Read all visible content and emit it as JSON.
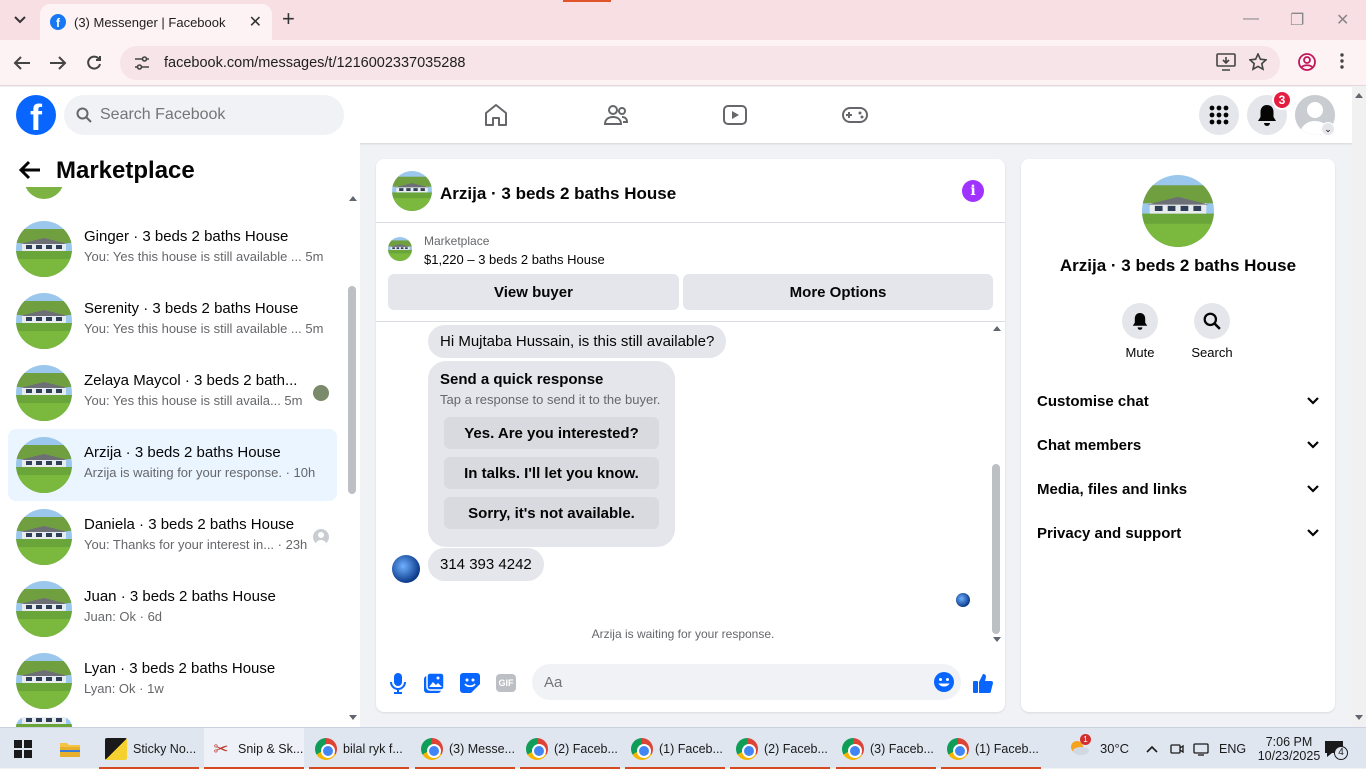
{
  "browser": {
    "tab_title": "(3) Messenger | Facebook",
    "url": "facebook.com/messages/t/1216002337035288"
  },
  "fb": {
    "logo": "f",
    "search_placeholder": "Search Facebook",
    "notifications_count": "3"
  },
  "left": {
    "title": "Marketplace",
    "conversations": [
      {
        "name": "Ginger · 3 beds 2 baths House",
        "preview": "You: Yes this house is still available ... 5m"
      },
      {
        "name": "Serenity · 3 beds 2 baths House",
        "preview": "You: Yes this house is still available ... 5m"
      },
      {
        "name": "Zelaya Maycol · 3 beds 2 bath...",
        "preview": "You: Yes this house is still availa...  5m"
      },
      {
        "name": "Arzija · 3 beds 2 baths House",
        "preview": "Arzija is waiting for your response. · 10h"
      },
      {
        "name": "Daniela · 3 beds 2 baths House",
        "preview": "You: Thanks for your interest in... · 23h"
      },
      {
        "name": "Juan · 3 beds 2 baths House",
        "preview": "Juan: Ok · 6d"
      },
      {
        "name": "Lyan · 3 beds 2 baths House",
        "preview": "Lyan: Ok · 1w"
      }
    ]
  },
  "chat": {
    "title": "Arzija · 3 beds 2 baths House",
    "marketplace_label": "Marketplace",
    "listing": "$1,220 – 3 beds 2 baths House",
    "view_buyer": "View buyer",
    "more_options": "More Options",
    "first_message": "Hi Mujtaba Hussain, is this still available?",
    "quick_title": "Send a quick response",
    "quick_subtitle": "Tap a response to send it to the buyer.",
    "quick_options": [
      "Yes. Are you interested?",
      "In talks. I'll let you know.",
      "Sorry, it's not available."
    ],
    "phone_message": "314 393 4242",
    "waiting": "Arzija is waiting for your response.",
    "composer_placeholder": "Aa",
    "gif_label": "GIF"
  },
  "right": {
    "name": "Arzija · 3 beds 2 baths House",
    "actions": [
      "Mute",
      "Search"
    ],
    "sections": [
      "Customise chat",
      "Chat members",
      "Media, files and links",
      "Privacy and support"
    ]
  },
  "taskbar": {
    "items": [
      "Sticky No...",
      "Snip & Sk...",
      "bilal ryk f...",
      "(3) Messe...",
      "(2) Faceb...",
      "(1) Faceb...",
      "(2) Faceb...",
      "(3) Faceb...",
      "(1) Faceb..."
    ],
    "weather_badge": "1",
    "temperature": "30°C",
    "language": "ENG",
    "time": "7:06 PM",
    "date": "10/23/2025",
    "notif_count": "4"
  },
  "colors": {
    "fb_blue": "#0866ff",
    "messenger_purple": "#a033ff",
    "active_bg": "#ebf5ff"
  }
}
